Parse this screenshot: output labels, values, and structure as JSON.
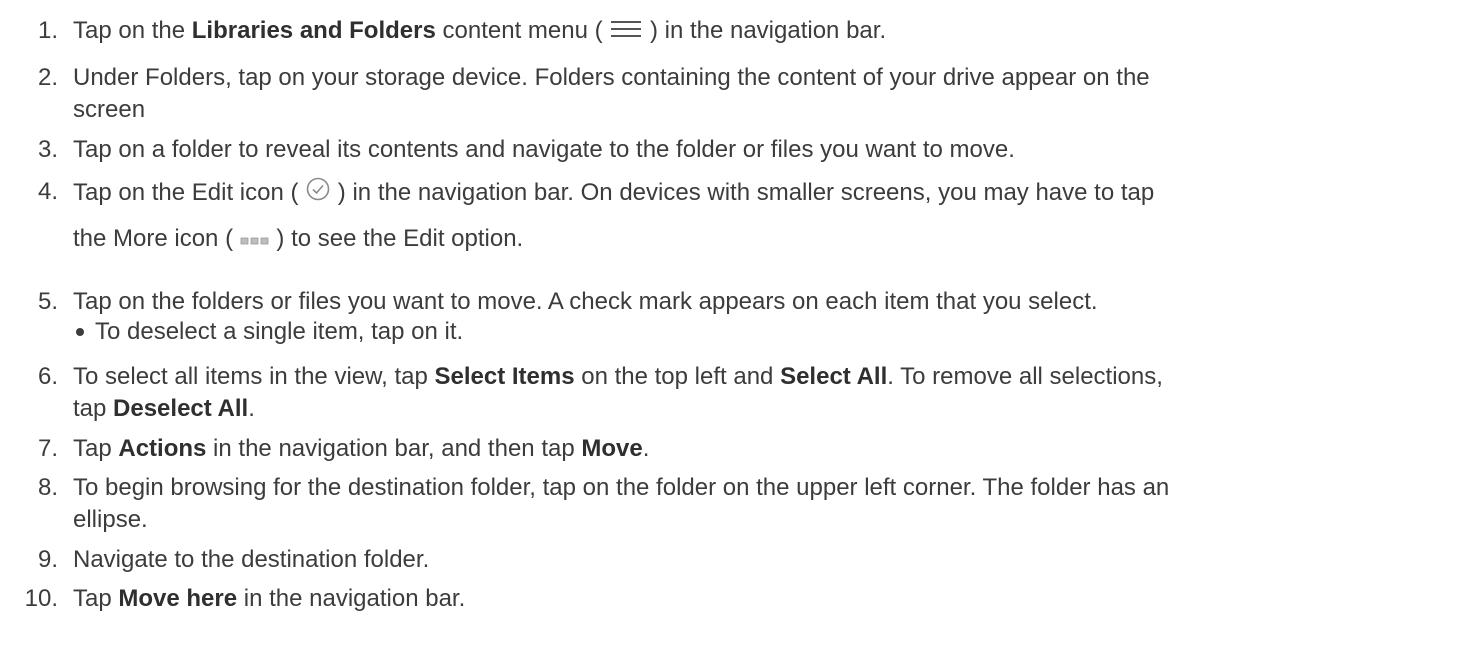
{
  "steps": [
    {
      "num": "1.",
      "pre": "Tap on the ",
      "b1": "Libraries and Folders",
      "post": " content menu ( ",
      "post2": " ) in the navigation bar.",
      "icon": "hamburger-menu-icon"
    },
    {
      "num": "2.",
      "line1": "Under Folders, tap on your storage device. Folders containing the content of your drive appear on the",
      "line2": "screen"
    },
    {
      "num": "3.",
      "text": "Tap on a folder to reveal its contents and navigate to the folder or files you want to move."
    },
    {
      "num": "4.",
      "pre": "Tap on the Edit icon ( ",
      "post": " ) in the navigation bar. On devices with smaller screens, you may have to tap",
      "icon": "check-circle-icon",
      "line2pre": "the More icon ( ",
      "line2post": " ) to see the Edit option.",
      "icon2": "more-dots-icon"
    },
    {
      "num": "5.",
      "text": "Tap on the folders or files you want to move. A check mark appears on each item that you select.",
      "sub": "To deselect a single item, tap on it."
    },
    {
      "num": "6.",
      "a": "To select all items in the view, tap ",
      "b1": "Select Items",
      "c": " on the top left and ",
      "b2": "Select All",
      "d": ". To remove all selections,",
      "line2a": "tap ",
      "line2b": "Deselect All",
      "line2c": "."
    },
    {
      "num": "7.",
      "a": "Tap ",
      "b1": "Actions",
      "c": " in the navigation bar, and then tap ",
      "b2": "Move",
      "d": "."
    },
    {
      "num": "8.",
      "line1": "To begin browsing for the destination folder, tap on the folder on the upper left corner. The folder has an",
      "line2": "ellipse."
    },
    {
      "num": "9.",
      "text": "Navigate to the destination folder."
    },
    {
      "num": "10.",
      "a": "Tap ",
      "b1": "Move here",
      "c": " in the navigation bar."
    }
  ]
}
